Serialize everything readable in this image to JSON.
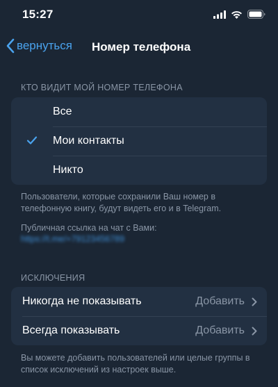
{
  "status_bar": {
    "time": "15:27"
  },
  "nav": {
    "back_label": "вернуться",
    "title": "Номер телефона"
  },
  "visibility": {
    "header": "КТО ВИДИТ МОЙ НОМЕР ТЕЛЕФОНА",
    "options": [
      {
        "label": "Все",
        "selected": false
      },
      {
        "label": "Мои контакты",
        "selected": true
      },
      {
        "label": "Никто",
        "selected": false
      }
    ],
    "footer": "Пользователи, которые сохранили Ваш номер в телефонную книгу, будут видеть его и в Telegram.",
    "public_link_label": "Публичная ссылка на чат с Вами:",
    "public_link": "https://t.me/+79123456789"
  },
  "exceptions": {
    "header": "ИСКЛЮЧЕНИЯ",
    "rows": [
      {
        "label": "Никогда не показывать",
        "action": "Добавить"
      },
      {
        "label": "Всегда показывать",
        "action": "Добавить"
      }
    ],
    "footer": "Вы можете добавить пользователей или целые группы в список исключений из настроек выше."
  },
  "colors": {
    "accent": "#4aa3ee",
    "background": "#1b2634",
    "cell": "#223042",
    "secondary_text": "#8a96a6"
  }
}
